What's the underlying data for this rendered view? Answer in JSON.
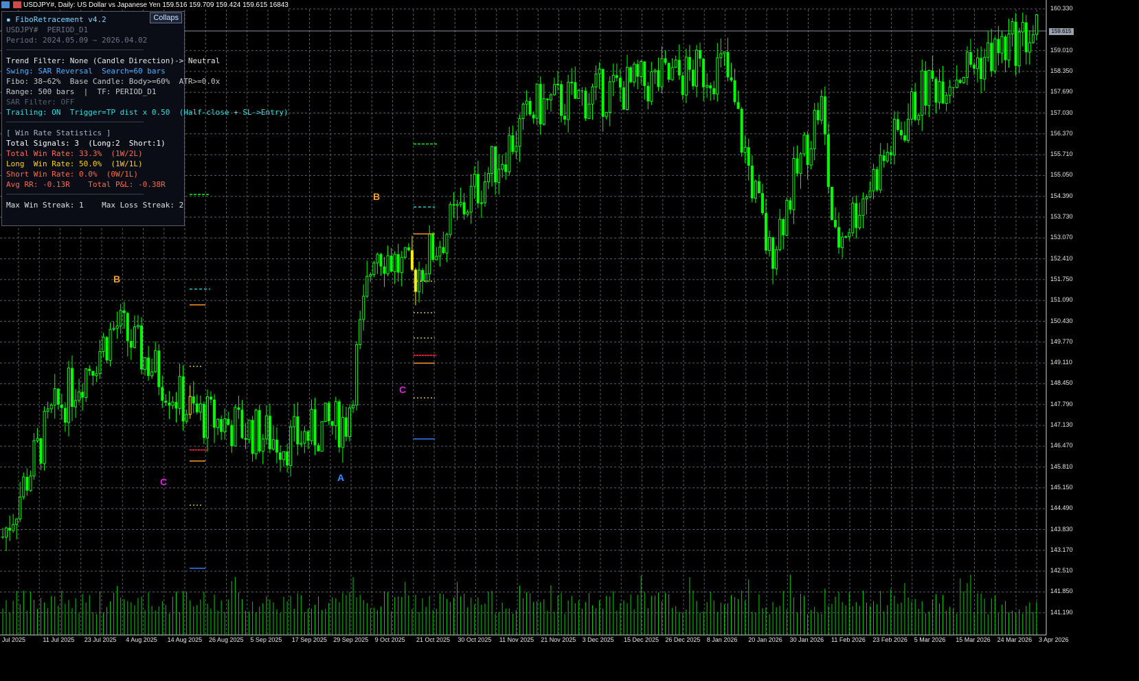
{
  "window": {
    "title": "USDJPY#, Daily: US Dollar vs Japanese Yen  159.516 159.709 159.424 159.615  16843"
  },
  "panel": {
    "title": "▪ FiboRetracement v4.2",
    "collapse_label": "Collaps",
    "symbol_line": "USDJPY#  PERIOD_D1",
    "period_line": "Period: 2024.05.09 ~ 2026.04.02",
    "trend_filter": "Trend Filter: None (Candle Direction)-> Neutral",
    "swing": "Swing: SAR Reversal  Search=60 bars",
    "fibo": "Fibo: 38~62%  Base Candle: Body>=60%  ATR>=0.0x",
    "range": "Range: 500 bars  |  TF: PERIOD_D1",
    "sar_filter": "SAR Filter: OFF",
    "trailing": "Trailing: ON  Trigger=TP dist x 0.50  (Half-close + SL->Entry)",
    "stats_header": "[ Win Rate Statistics ]",
    "total_signals": "Total Signals: 3  (Long:2  Short:1)",
    "total_win_rate": "Total Win Rate: 33.3%  (1W/2L)",
    "long_win_rate": "Long  Win Rate: 50.0%  (1W/1L)",
    "short_win_rate": "Short Win Rate: 0.0%  (0W/1L)",
    "avg_rr": "Avg RR: -0.13R    Total P&L: -0.38R",
    "streaks": "Max Win Streak: 1    Max Loss Streak: 2"
  },
  "current_price": "159.615",
  "y_labels": [
    "160.330",
    "159.010",
    "158.350",
    "157.690",
    "157.030",
    "156.370",
    "155.710",
    "155.050",
    "154.390",
    "153.730",
    "153.070",
    "152.410",
    "151.750",
    "151.090",
    "150.430",
    "149.770",
    "149.110",
    "148.450",
    "147.790",
    "147.130",
    "146.470",
    "145.810",
    "145.150",
    "144.490",
    "143.830",
    "143.170",
    "142.510",
    "141.850",
    "141.190"
  ],
  "x_labels": [
    "Jul 2025",
    "11 Jul 2025",
    "23 Jul 2025",
    "4 Aug 2025",
    "14 Aug 2025",
    "26 Aug 2025",
    "5 Sep 2025",
    "17 Sep 2025",
    "29 Sep 2025",
    "9 Oct 2025",
    "21 Oct 2025",
    "30 Oct 2025",
    "11 Nov 2025",
    "21 Nov 2025",
    "3 Dec 2025",
    "15 Dec 2025",
    "26 Dec 2025",
    "8 Jan 2026",
    "20 Jan 2026",
    "30 Jan 2026",
    "11 Feb 2026",
    "23 Feb 2026",
    "5 Mar 2026",
    "15 Mar 2026",
    "24 Mar 2026",
    "3 Apr 2026"
  ],
  "markers": [
    {
      "label": "B",
      "color": "#f0a030"
    },
    {
      "label": "C",
      "color": "#e020e0"
    },
    {
      "label": "A",
      "color": "#3090ff"
    },
    {
      "label": "B",
      "color": "#f0a030"
    },
    {
      "label": "C",
      "color": "#e020e0"
    }
  ],
  "colors": {
    "candle": "#00ff00",
    "signal_candle": "#ffee00",
    "grid": "#5a5f6a",
    "bid_line": "#8a8f9a",
    "volume": "#00d000",
    "tp_green": "#00ff00",
    "teal": "#20c8c8",
    "orange": "#ff9c20",
    "yellow": "#d7c43a",
    "red": "#ff3050",
    "blue": "#2d7dff"
  },
  "chart_data": {
    "type": "candlestick",
    "symbol": "USDJPY#",
    "timeframe": "Daily",
    "last_bar": {
      "open": 159.516,
      "high": 159.709,
      "low": 159.424,
      "close": 159.615,
      "volume": 16843
    },
    "ylim": [
      140.9,
      160.45
    ],
    "key_points": [
      {
        "date": "Jul 2025",
        "close": 143.6
      },
      {
        "date": "11 Jul 2025",
        "close": 147.4
      },
      {
        "date": "29 Jul 2025",
        "close": 150.3
      },
      {
        "date": "14 Aug 2025",
        "close": 147.5
      },
      {
        "date": "17 Sep 2025",
        "close": 146.6
      },
      {
        "date": "29 Sep 2025",
        "close": 147.3
      },
      {
        "date": "9 Oct 2025",
        "close": 152.9
      },
      {
        "date": "21 Oct 2025",
        "close": 151.8
      },
      {
        "date": "21 Nov 2025",
        "close": 157.2
      },
      {
        "date": "8 Jan 2026",
        "close": 158.5
      },
      {
        "date": "20 Jan 2026",
        "close": 152.5
      },
      {
        "date": "30 Jan 2026",
        "close": 157.4
      },
      {
        "date": "11 Feb 2026",
        "close": 152.8
      },
      {
        "date": "5 Mar 2026",
        "close": 157.8
      },
      {
        "date": "3 Apr 2026",
        "close": 159.615
      }
    ]
  }
}
